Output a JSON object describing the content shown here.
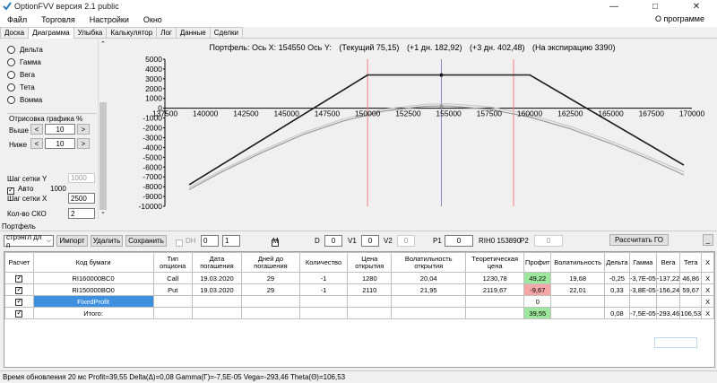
{
  "window": {
    "title": "OptionFVV версия 2.1 public"
  },
  "menu": {
    "items": [
      "Файл",
      "Торговля",
      "Настройки",
      "Окно"
    ],
    "about": "О программе"
  },
  "tabs": [
    "Доска",
    "Диаграмма",
    "Улыбка",
    "Калькулятор",
    "Лог",
    "Данные",
    "Сделки"
  ],
  "active_tab": "Диаграмма",
  "left_panel": {
    "greeks": [
      "Дельта",
      "Гамма",
      "Вега",
      "Тета",
      "Вомма"
    ],
    "draw_label": "Отрисовка графика %",
    "above_label": "Выше",
    "above_value": "10",
    "below_label": "Ниже",
    "below_value": "10",
    "step_y_label": "Шаг сетки Y",
    "step_y_value": "1000",
    "auto_label": "Авто",
    "auto_value": "1000",
    "step_x_label": "Шаг сетки X",
    "step_x_value": "2500",
    "sko_label": "Кол-во СКО",
    "sko_value": "2",
    "left_arrow": "<",
    "right_arrow": ">"
  },
  "chart_header": {
    "portfolio": "Портфель: Ось X: 154550 Ось Y:",
    "current": "(Текущий 75,15)",
    "plus1": "(+1 дн. 182,92)",
    "plus3": "(+3 дн. 402,48)",
    "expiry": "(На экспирацию 3390)"
  },
  "chart_data": {
    "type": "line",
    "xlim": [
      137500,
      170000
    ],
    "ylim": [
      -10000,
      5000
    ],
    "x_ticks": [
      137500,
      140000,
      142500,
      145000,
      147500,
      150000,
      152500,
      155000,
      157500,
      160000,
      162500,
      165000,
      167500,
      170000
    ],
    "y_ticks": [
      5000,
      4000,
      3000,
      2000,
      1000,
      0,
      -1000,
      -2000,
      -3000,
      -4000,
      -5000,
      -6000,
      -7000,
      -8000,
      -9000,
      -10000
    ],
    "current_x": 154550,
    "red_lines_x": [
      150000,
      159000
    ],
    "series": [
      {
        "color": "#1a1a1a",
        "points": [
          [
            139000,
            -7800
          ],
          [
            150000,
            3390
          ],
          [
            160000,
            3390
          ],
          [
            169500,
            -5800
          ]
        ]
      },
      {
        "color": "#9a9a9a",
        "points": [
          [
            139000,
            -8300
          ],
          [
            141000,
            -6500
          ],
          [
            143500,
            -4500
          ],
          [
            146000,
            -2700
          ],
          [
            148500,
            -1300
          ],
          [
            151000,
            -300
          ],
          [
            153500,
            200
          ],
          [
            155000,
            230
          ],
          [
            157500,
            -100
          ],
          [
            160000,
            -900
          ],
          [
            162500,
            -2100
          ],
          [
            165000,
            -3600
          ],
          [
            167500,
            -5300
          ],
          [
            169500,
            -6800
          ]
        ]
      },
      {
        "color": "#c8c8c8",
        "points": [
          [
            139000,
            -8100
          ],
          [
            141000,
            -6300
          ],
          [
            143500,
            -4300
          ],
          [
            146000,
            -2500
          ],
          [
            148500,
            -1100
          ],
          [
            151000,
            -100
          ],
          [
            153500,
            400
          ],
          [
            155000,
            450
          ],
          [
            157500,
            150
          ],
          [
            160000,
            -650
          ],
          [
            162500,
            -1850
          ],
          [
            165000,
            -3350
          ],
          [
            167500,
            -5050
          ],
          [
            169500,
            -6500
          ]
        ]
      }
    ],
    "current_points": [
      {
        "x": 154550,
        "y": 3390,
        "color": "#1a1a1a"
      },
      {
        "x": 154550,
        "y": 230,
        "color": "#9a9a9a"
      }
    ]
  },
  "portfolio": {
    "section_label": "Портфель",
    "select_value": "стрэнгл дл п",
    "import_btn": "Импорт",
    "delete_btn": "Удалить",
    "save_btn": "Сохранить",
    "dh_label": "DH",
    "dh_hours": "0",
    "dh_minutes": "1",
    "m_label": "M",
    "d_label": "D",
    "d_value": "0",
    "v1_label": "V1",
    "v1_value": "0",
    "v2_label": "V2",
    "v2_value": "0",
    "p1_label": "P1",
    "p1_value": "0",
    "rih_label": "RIH0 153890",
    "p2_label": "P2",
    "p2_value": "0",
    "calc_go_btn": "Рассчитать ГО",
    "min_btn": "_"
  },
  "table": {
    "headers": [
      "Расчет",
      "Код бумаги",
      "Тип опциона",
      "Дата погашения",
      "Дней до погашения",
      "Количество",
      "Цена открытия",
      "Волатильность открытия",
      "Теоретическая цена",
      "Профит",
      "Волатильность",
      "Дельта",
      "Гамма",
      "Вега",
      "Тета",
      "X"
    ],
    "rows": [
      [
        "RI160000BC0",
        "Call",
        "19.03.2020",
        "29",
        "-1",
        "1280",
        "20,04",
        "1230,78",
        "49,22",
        "19,68",
        "-0,25",
        "-3,7E-05",
        "-137,22",
        "46,86",
        "X"
      ],
      [
        "RI150000BO0",
        "Put",
        "19.03.2020",
        "29",
        "-1",
        "2110",
        "21,95",
        "2119,67",
        "-9,67",
        "22,01",
        "0,33",
        "-3,8E-05",
        "-156,24",
        "59,67",
        "X"
      ],
      [
        "FixedProfit",
        "",
        "",
        "",
        "",
        "",
        "",
        "",
        "0",
        "",
        "",
        "",
        "",
        "",
        "X"
      ],
      [
        "Итого:",
        "",
        "",
        "",
        "",
        "",
        "",
        "",
        "39,55",
        "",
        "0,08",
        "-7,5E-05",
        "-293,46",
        "106,53",
        "X"
      ]
    ]
  },
  "status": {
    "text": "Время обновления 20 мс  Profit=39,55 Delta(Δ)=0,08 Gamma(Γ)=-7,5E-05 Vega=-293,46 Theta(Θ)=106,53"
  },
  "colors": {
    "profit_positive": "#9ee79e",
    "profit_negative": "#f5a6a6",
    "fixed_row": "#3d8fe0"
  }
}
